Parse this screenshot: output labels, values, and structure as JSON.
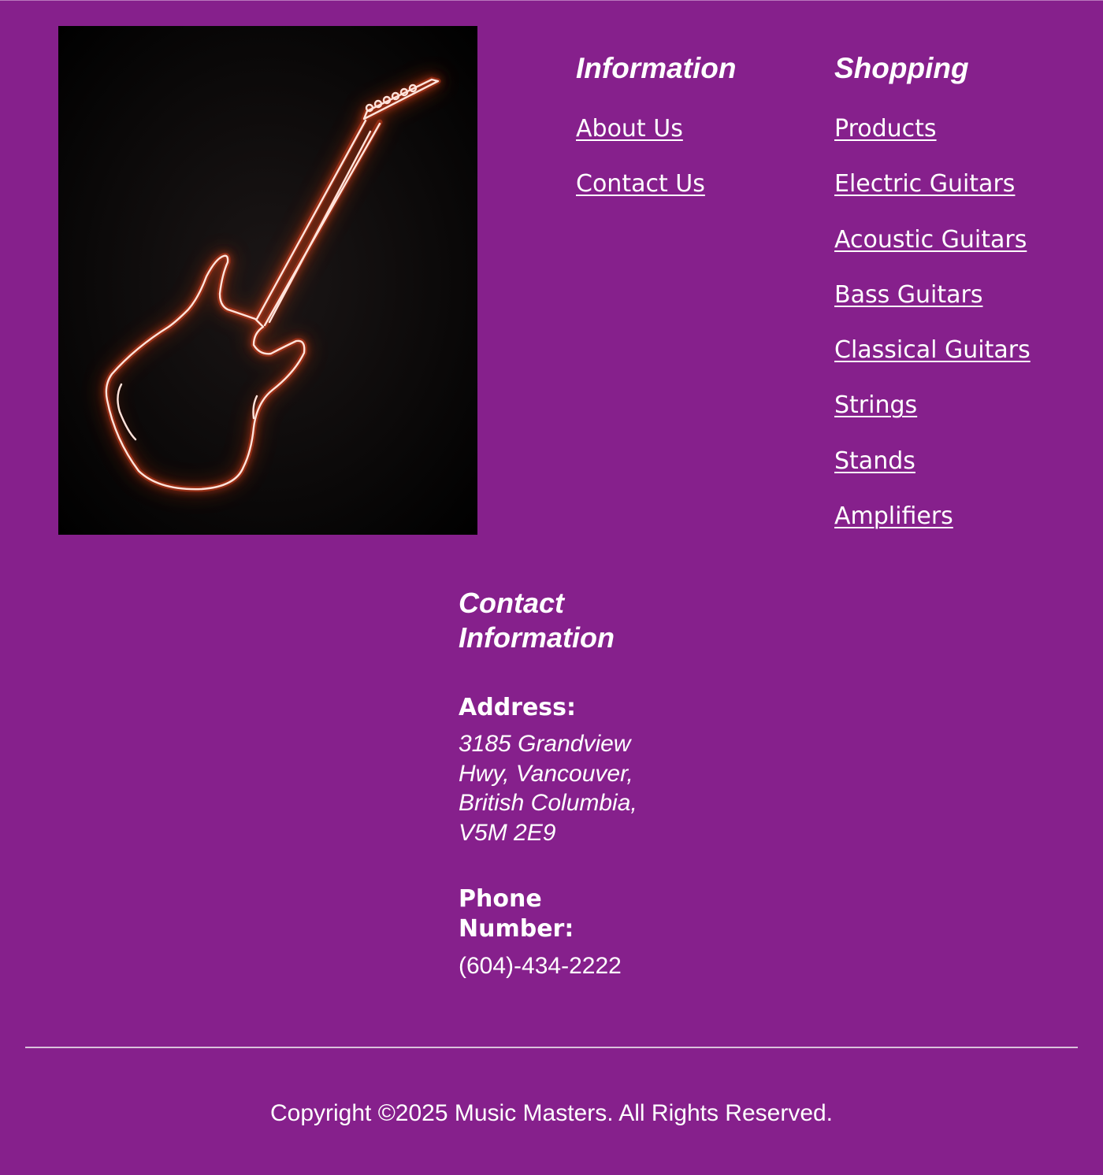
{
  "information": {
    "heading": "Information",
    "links": [
      "About Us",
      "Contact Us"
    ]
  },
  "shopping": {
    "heading": "Shopping",
    "links": [
      "Products",
      "Electric Guitars",
      "Acoustic Guitars",
      "Bass Guitars",
      "Classical Guitars",
      "Strings",
      "Stands",
      "Amplifiers"
    ]
  },
  "contact": {
    "heading": "Contact Information",
    "address_label": "Address:",
    "address": "3185 Grandview Hwy, Vancouver, British Columbia, V5M 2E9",
    "phone_label": "Phone Number:",
    "phone": "(604)-434-2222"
  },
  "footer": {
    "copyright": "Copyright ©2025 Music Masters. All Rights Reserved."
  },
  "colors": {
    "background": "#86208c",
    "text": "#ffffff",
    "neon": "#ff5a2e"
  },
  "image": {
    "icon": "neon-electric-guitar-icon"
  }
}
